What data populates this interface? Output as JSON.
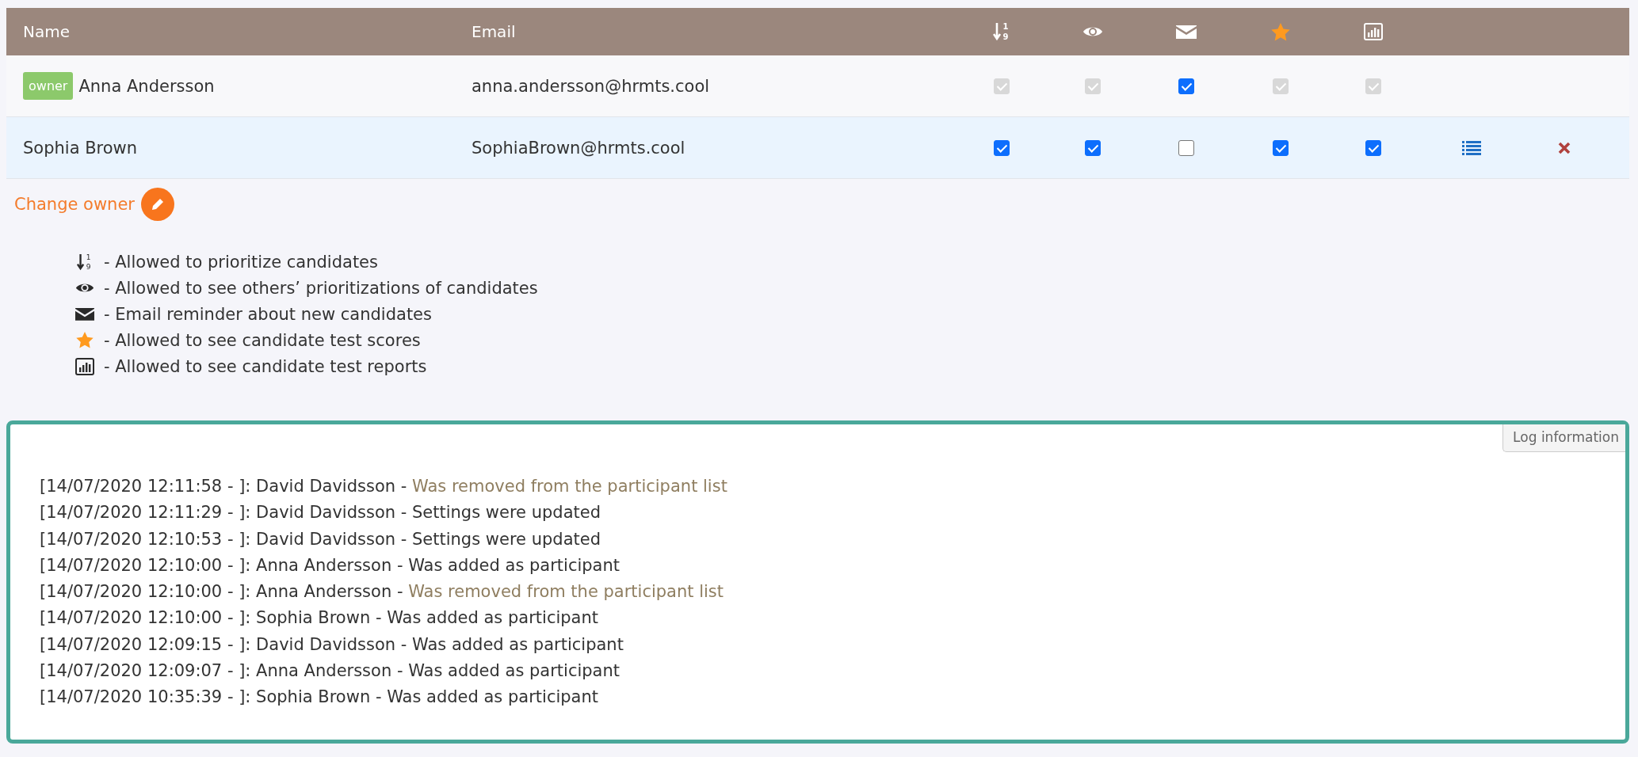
{
  "table": {
    "name_header": "Name",
    "email_header": "Email",
    "permission_columns": [
      {
        "kind": "sort",
        "digits": [
          "1",
          "9"
        ]
      },
      {
        "kind": "eye"
      },
      {
        "kind": "envelope"
      },
      {
        "kind": "star"
      },
      {
        "kind": "chart"
      }
    ],
    "rows": [
      {
        "badge": "owner",
        "name": "Anna Andersson",
        "email": "anna.andersson@hrmts.cool",
        "selected": false,
        "actions": false,
        "permissions": [
          {
            "checked": true,
            "disabled": true
          },
          {
            "checked": true,
            "disabled": true
          },
          {
            "checked": true,
            "disabled": false
          },
          {
            "checked": true,
            "disabled": true
          },
          {
            "checked": true,
            "disabled": true
          }
        ]
      },
      {
        "name": "Sophia Brown",
        "email": "SophiaBrown@hrmts.cool",
        "selected": true,
        "actions": true,
        "permissions": [
          {
            "checked": true,
            "disabled": false
          },
          {
            "checked": true,
            "disabled": false
          },
          {
            "checked": false,
            "disabled": false
          },
          {
            "checked": true,
            "disabled": false
          },
          {
            "checked": true,
            "disabled": false
          }
        ]
      }
    ]
  },
  "change_owner": "Change owner",
  "legend": [
    {
      "kind": "sort",
      "digits": [
        "1",
        "9"
      ],
      "text": "- Allowed to prioritize candidates"
    },
    {
      "kind": "eye",
      "text": "- Allowed to see others’ prioritizations of candidates"
    },
    {
      "kind": "envelope",
      "text": "- Email reminder about new candidates"
    },
    {
      "kind": "star",
      "text": "- Allowed to see candidate test scores"
    },
    {
      "kind": "chart",
      "text": "- Allowed to see candidate test reports"
    }
  ],
  "log": {
    "tab": "Log information",
    "entries": [
      {
        "source": "[14/07/2020 12:11:58 - ]: David Davidsson -",
        "event": "Was removed from the participant list",
        "kind": "removed"
      },
      {
        "source": "[14/07/2020 12:11:29 - ]: David Davidsson -",
        "event": "Settings were updated",
        "kind": "normal"
      },
      {
        "source": "[14/07/2020 12:10:53 - ]: David Davidsson -",
        "event": "Settings were updated",
        "kind": "normal"
      },
      {
        "source": "[14/07/2020 12:10:00 - ]: Anna Andersson -",
        "event": "Was added as participant",
        "kind": "normal"
      },
      {
        "source": "[14/07/2020 12:10:00 - ]: Anna Andersson -",
        "event": "Was removed from the participant list",
        "kind": "removed"
      },
      {
        "source": "[14/07/2020 12:10:00 - ]: Sophia Brown -",
        "event": "Was added as participant",
        "kind": "normal"
      },
      {
        "source": "[14/07/2020 12:09:15 - ]: David Davidsson -",
        "event": "Was added as participant",
        "kind": "normal"
      },
      {
        "source": "[14/07/2020 12:09:07 - ]: Anna Andersson -",
        "event": "Was added as participant",
        "kind": "normal"
      },
      {
        "source": "[14/07/2020 10:35:39 - ]: Sophia Brown -",
        "event": "Was added as participant",
        "kind": "normal"
      }
    ]
  }
}
